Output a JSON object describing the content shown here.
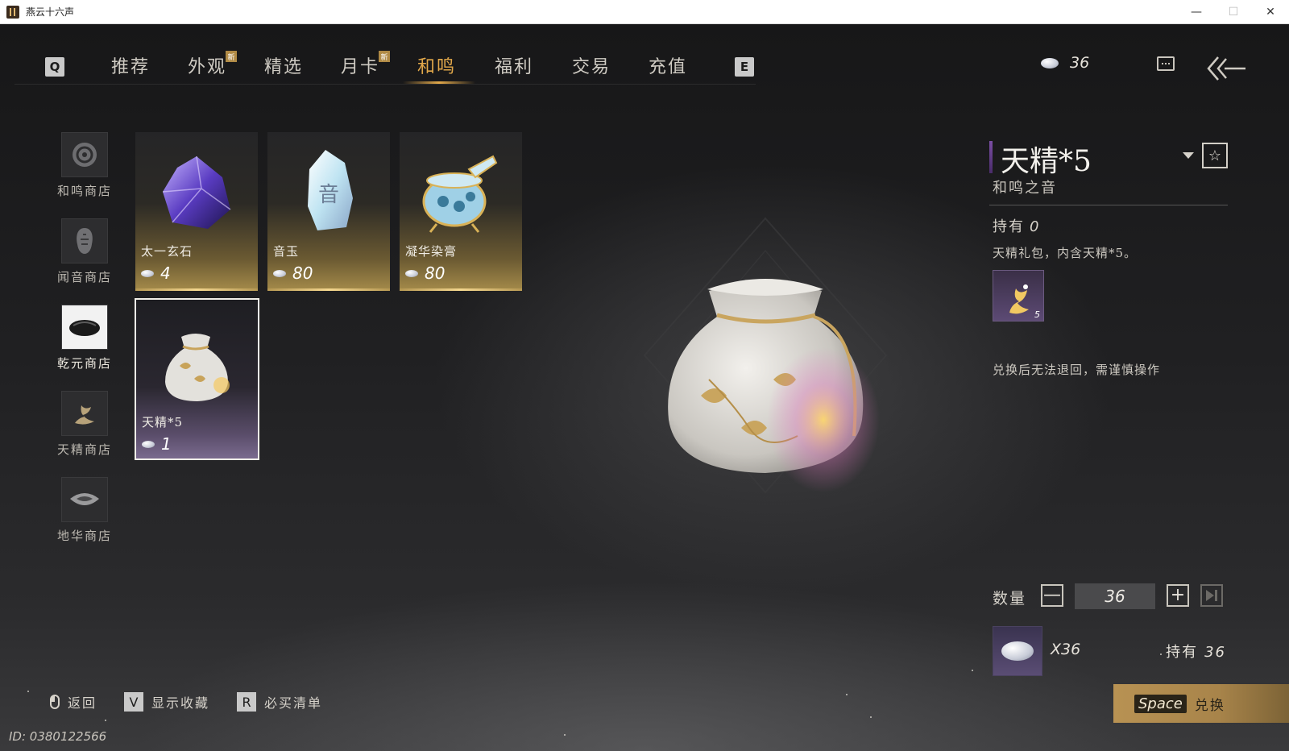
{
  "window": {
    "title": "燕云十六声",
    "minimize": "—",
    "maximize": "☐",
    "close": "✕"
  },
  "nav": {
    "left_key": "Q",
    "right_key": "E",
    "new_badge": "新",
    "tabs": [
      {
        "label": "推荐",
        "active": false,
        "new": false
      },
      {
        "label": "外观",
        "active": false,
        "new": true
      },
      {
        "label": "精选",
        "active": false,
        "new": false
      },
      {
        "label": "月卡",
        "active": false,
        "new": true
      },
      {
        "label": "和鸣",
        "active": true,
        "new": false
      },
      {
        "label": "福利",
        "active": false,
        "new": false
      },
      {
        "label": "交易",
        "active": false,
        "new": false
      },
      {
        "label": "充值",
        "active": false,
        "new": false
      }
    ],
    "currency_amount": "36",
    "accent_color": "#e2a84a"
  },
  "shops": [
    {
      "label": "和鸣商店",
      "icon": "resonance-shop-icon",
      "selected": false
    },
    {
      "label": "闻音商店",
      "icon": "wenyin-shop-icon",
      "selected": false
    },
    {
      "label": "乾元商店",
      "icon": "qianyuan-shop-icon",
      "selected": true
    },
    {
      "label": "天精商店",
      "icon": "tianjing-shop-icon",
      "selected": false
    },
    {
      "label": "地华商店",
      "icon": "dihua-shop-icon",
      "selected": false
    }
  ],
  "items": [
    {
      "name": "太一玄石",
      "price": "4",
      "icon": "purple-ore-icon",
      "selected": false
    },
    {
      "name": "音玉",
      "price": "80",
      "icon": "sound-jade-icon",
      "selected": false
    },
    {
      "name": "凝华染膏",
      "price": "80",
      "icon": "dye-jar-icon",
      "selected": false
    },
    {
      "name": "天精*5",
      "price": "1",
      "icon": "gift-bag-icon",
      "selected": true
    }
  ],
  "detail": {
    "title": "天精*5",
    "subtitle": "和鸣之音",
    "owned_label": "持有",
    "owned_value": "0",
    "description": "天精礼包，内含天精*5。",
    "content_count": "5",
    "warning": "兑换后无法退回，需谨慎操作",
    "fav_icon": "☆"
  },
  "quantity": {
    "label": "数量",
    "value": "36",
    "minus": "—",
    "plus": "+"
  },
  "cost": {
    "amount": "X36",
    "owned_label": "持有",
    "owned_value": "36"
  },
  "exchange": {
    "key": "Space",
    "label": "兑换"
  },
  "hints": {
    "back": "返回",
    "fav_key": "V",
    "fav": "显示收藏",
    "list_key": "R",
    "list": "必买清单"
  },
  "player_id": "ID: 0380122566"
}
